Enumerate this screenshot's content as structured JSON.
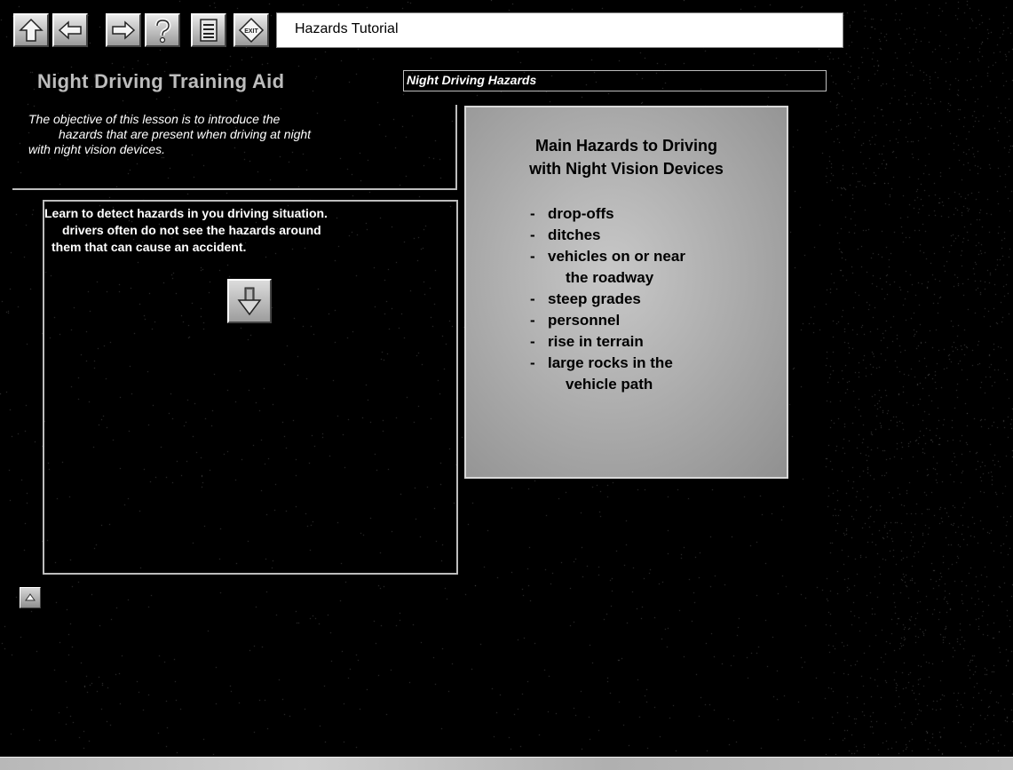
{
  "toolbar": {
    "buttons": [
      {
        "name": "up-arrow-icon"
      },
      {
        "name": "back-arrow-icon"
      },
      {
        "name": "forward-arrow-icon"
      },
      {
        "name": "help-icon"
      },
      {
        "name": "contents-icon"
      },
      {
        "name": "exit-icon",
        "label": "EXIT"
      }
    ],
    "title": "Hazards Tutorial"
  },
  "header": {
    "app_title": "Night Driving Training Aid",
    "section_title": "Night Driving Hazards"
  },
  "objective": {
    "lines": [
      "The objective of this lesson is to introduce the",
      "hazards that are present when driving at night",
      "with night vision devices."
    ]
  },
  "content": {
    "lines": [
      "Learn to detect hazards in you driving situation.",
      "drivers often do not see the hazards around",
      "them that can cause an accident."
    ],
    "next_icon": "down-arrow-icon"
  },
  "hazards": {
    "title_lines": [
      "Main Hazards to Driving",
      "with Night Vision Devices"
    ],
    "items": [
      {
        "text": "drop-offs"
      },
      {
        "text": "ditches"
      },
      {
        "text": "vehicles on or near",
        "cont": "the roadway"
      },
      {
        "text": "steep grades"
      },
      {
        "text": "personnel"
      },
      {
        "text": "rise in terrain"
      },
      {
        "text": "large rocks in the",
        "cont": "vehicle path"
      }
    ]
  },
  "colors": {
    "background": "#000000",
    "panel_border": "#bdbdbd",
    "card_background": "#b4b4b4"
  }
}
